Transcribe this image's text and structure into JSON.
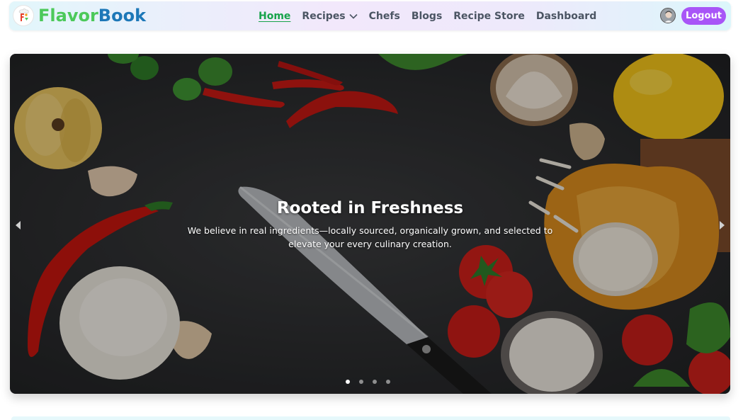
{
  "brand": {
    "part1": "Flavor",
    "part2": "Book",
    "logo_icon": "chef-logo-icon"
  },
  "nav": {
    "items": [
      {
        "label": "Home",
        "active": true
      },
      {
        "label": "Recipes",
        "has_dropdown": true
      },
      {
        "label": "Chefs"
      },
      {
        "label": "Blogs"
      },
      {
        "label": "Recipe Store"
      },
      {
        "label": "Dashboard"
      }
    ]
  },
  "user": {
    "avatar_icon": "user-avatar",
    "logout_label": "Logout"
  },
  "hero": {
    "title": "Rooted in Freshness",
    "subtitle": "We believe in real ingredients—locally sourced, organically grown, and selected to elevate your every culinary creation.",
    "prev_icon": "chevron-left-icon",
    "next_icon": "chevron-right-icon",
    "slides_count": 4,
    "active_slide": 1
  },
  "colors": {
    "brand_green": "#4cc95a",
    "brand_blue": "#1d78b8",
    "active_nav": "#16a34a",
    "logout_bg": "#a855f7"
  }
}
